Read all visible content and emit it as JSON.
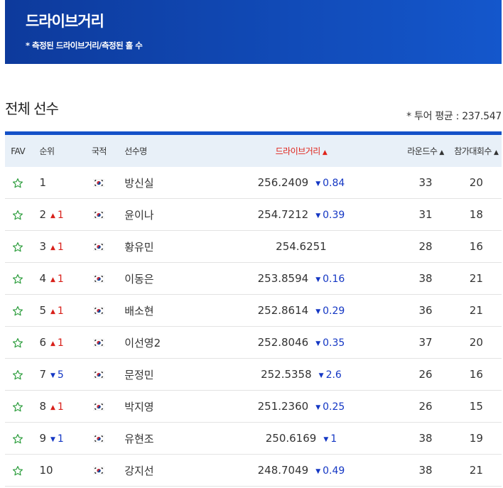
{
  "banner": {
    "title": "드라이브거리",
    "subtitle": "* 측정된 드라이브거리/측정된 홀 수"
  },
  "section_title": "전체 선수",
  "tour_average": "* 투어 평균 : 237.547",
  "headers": {
    "fav": "FAV",
    "rank": "순위",
    "nationality": "국적",
    "name": "선수명",
    "drive": "드라이브거리",
    "rounds": "라운드수",
    "events": "참가대회수",
    "sort_arrow": "▲"
  },
  "colors": {
    "banner": "#1451c8",
    "up": "#d8201a",
    "down": "#1437c4",
    "star": "#2e9e3e"
  },
  "rows": [
    {
      "rank": "1",
      "rank_change": "",
      "rank_dir": "",
      "name": "방신실",
      "drive": "256.2409",
      "drive_change": "0.84",
      "rounds": "33",
      "events": "20"
    },
    {
      "rank": "2",
      "rank_change": "1",
      "rank_dir": "up",
      "name": "윤이나",
      "drive": "254.7212",
      "drive_change": "0.39",
      "rounds": "31",
      "events": "18"
    },
    {
      "rank": "3",
      "rank_change": "1",
      "rank_dir": "up",
      "name": "황유민",
      "drive": "254.6251",
      "drive_change": "",
      "rounds": "28",
      "events": "16"
    },
    {
      "rank": "4",
      "rank_change": "1",
      "rank_dir": "up",
      "name": "이동은",
      "drive": "253.8594",
      "drive_change": "0.16",
      "rounds": "38",
      "events": "21"
    },
    {
      "rank": "5",
      "rank_change": "1",
      "rank_dir": "up",
      "name": "배소현",
      "drive": "252.8614",
      "drive_change": "0.29",
      "rounds": "36",
      "events": "21"
    },
    {
      "rank": "6",
      "rank_change": "1",
      "rank_dir": "up",
      "name": "이선영2",
      "drive": "252.8046",
      "drive_change": "0.35",
      "rounds": "37",
      "events": "20"
    },
    {
      "rank": "7",
      "rank_change": "5",
      "rank_dir": "down",
      "name": "문정민",
      "drive": "252.5358",
      "drive_change": "2.6",
      "rounds": "26",
      "events": "16"
    },
    {
      "rank": "8",
      "rank_change": "1",
      "rank_dir": "up",
      "name": "박지영",
      "drive": "251.2360",
      "drive_change": "0.25",
      "rounds": "26",
      "events": "15"
    },
    {
      "rank": "9",
      "rank_change": "1",
      "rank_dir": "down",
      "name": "유현조",
      "drive": "250.6169",
      "drive_change": "1",
      "rounds": "38",
      "events": "19"
    },
    {
      "rank": "10",
      "rank_change": "",
      "rank_dir": "",
      "name": "강지선",
      "drive": "248.7049",
      "drive_change": "0.49",
      "rounds": "38",
      "events": "21"
    }
  ]
}
